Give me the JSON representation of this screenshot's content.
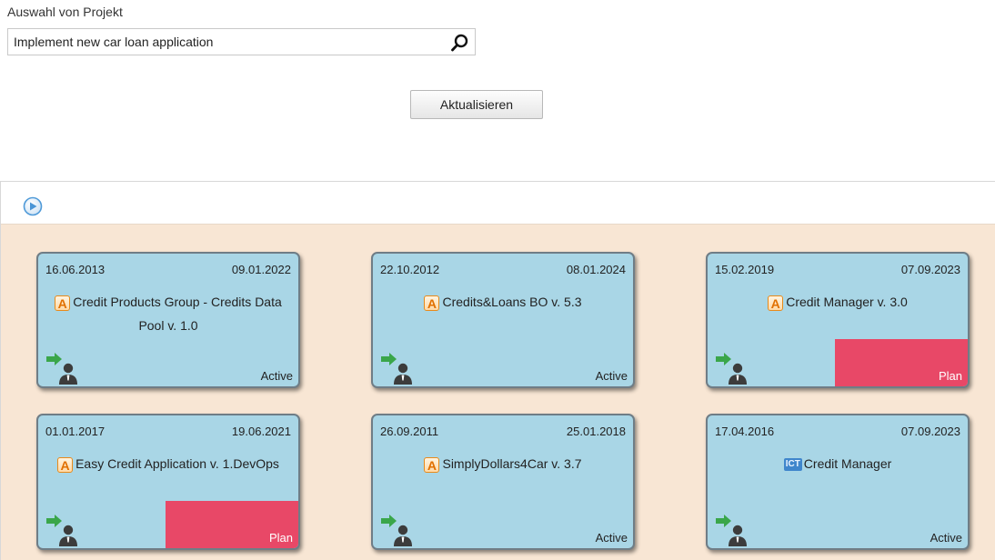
{
  "project_selector": {
    "label": "Auswahl von Projekt",
    "value": "Implement new car loan application",
    "search_icon": "magnifier-icon"
  },
  "refresh_button": {
    "label": "Aktualisieren"
  },
  "panel": {
    "nav_icon": "play-circle-icon",
    "background_color": "#f8e6d4"
  },
  "card_colors": {
    "card_fill": "#a9d6e6",
    "card_border": "#6f7d86",
    "plan_fill": "#e84867",
    "arrow_green": "#3aa64a"
  },
  "cards": [
    {
      "start_date": "16.06.2013",
      "end_date": "09.01.2022",
      "type_badge": "A",
      "title": "Credit Products Group - Credits Data Pool v. 1.0",
      "status": "Active"
    },
    {
      "start_date": "22.10.2012",
      "end_date": "08.01.2024",
      "type_badge": "A",
      "title": "Credits&Loans BO v. 5.3",
      "status": "Active"
    },
    {
      "start_date": "15.02.2019",
      "end_date": "07.09.2023",
      "type_badge": "A",
      "title": "Credit Manager v. 3.0",
      "status": "Plan"
    },
    {
      "start_date": "01.01.2017",
      "end_date": "19.06.2021",
      "type_badge": "A",
      "title": "Easy Credit Application v. 1.DevOps",
      "status": "Plan"
    },
    {
      "start_date": "26.09.2011",
      "end_date": "25.01.2018",
      "type_badge": "A",
      "title": "SimplyDollars4Car v. 3.7",
      "status": "Active"
    },
    {
      "start_date": "17.04.2016",
      "end_date": "07.09.2023",
      "type_badge": "ICT",
      "title": "Credit Manager",
      "status": "Active"
    }
  ]
}
